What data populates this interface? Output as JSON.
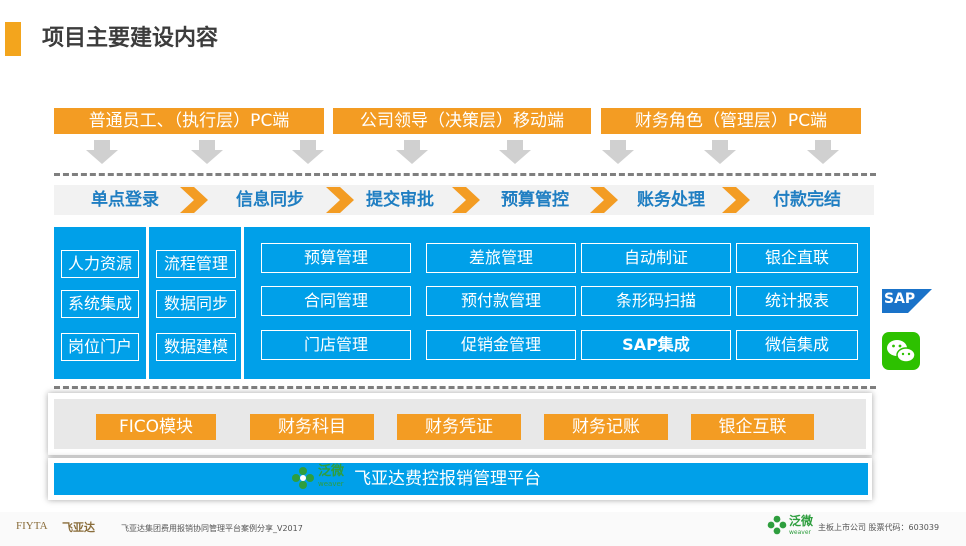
{
  "header": {
    "title": "项目主要建设内容"
  },
  "roles": [
    "普通员工、（执行层）PC端",
    "公司领导（决策层）移动端",
    "财务角色（管理层）PC端"
  ],
  "flow": [
    "单点登录",
    "信息同步",
    "提交审批",
    "预算管控",
    "账务处理",
    "付款完结"
  ],
  "left_column_1": [
    "人力资源",
    "系统集成",
    "岗位门户"
  ],
  "left_column_2": [
    "流程管理",
    "数据同步",
    "数据建模"
  ],
  "modules": [
    [
      "预算管理",
      "差旅管理",
      "自动制证",
      "银企直联"
    ],
    [
      "合同管理",
      "预付款管理",
      "条形码扫描",
      "统计报表"
    ],
    [
      "门店管理",
      "促销金管理",
      "SAP集成",
      "微信集成"
    ]
  ],
  "side_logos": {
    "sap": "SAP",
    "wechat_icon": "wechat-icon"
  },
  "fico_modules": [
    "FICO模块",
    "财务科目",
    "财务凭证",
    "财务记账",
    "银企互联"
  ],
  "platform": {
    "brand": "泛微",
    "brand_sub": "weaver",
    "label": "飞亚达费控报销管理平台"
  },
  "footer": {
    "left_logo": "FIYTA",
    "left_logo_cn": "飞亚达",
    "left_text": "飞亚达集团费用报销协同管理平台案例分享_V2017",
    "right_brand": "泛微",
    "right_brand_sub": "weaver",
    "right_text": "主板上市公司  股票代码：603039"
  },
  "colors": {
    "accent_orange": "#f39c23",
    "primary_blue": "#00a0e9",
    "flow_text": "#1f7ec2"
  }
}
